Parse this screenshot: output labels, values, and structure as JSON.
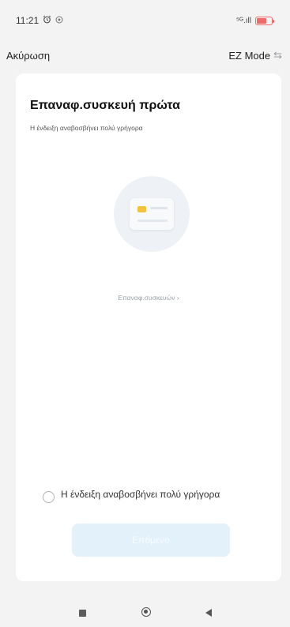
{
  "status_bar": {
    "time": "11:21",
    "alarm_icon": "alarm-clock-icon",
    "notification_icon": "radar-icon",
    "signal_text": "⁵ᴳ.ıll"
  },
  "nav": {
    "cancel_label": "Ακύρωση",
    "mode_label": "EZ Mode",
    "mode_icon": "⇆"
  },
  "content": {
    "title": "Επαναφ.συσκευή πρώτα",
    "subtitle": "Η ένδειξη αναβοσβήνει πολύ γρήγορα",
    "reset_link": "Επαναφ.συσκευών ›",
    "confirm_label": "Η ένδειξη αναβοσβήνει πολύ γρήγορα",
    "next_button": "Επόμενο"
  },
  "colors": {
    "accent": "#e3f1fb",
    "battery": "#f06a6a",
    "lamp": "#f5c33b"
  }
}
